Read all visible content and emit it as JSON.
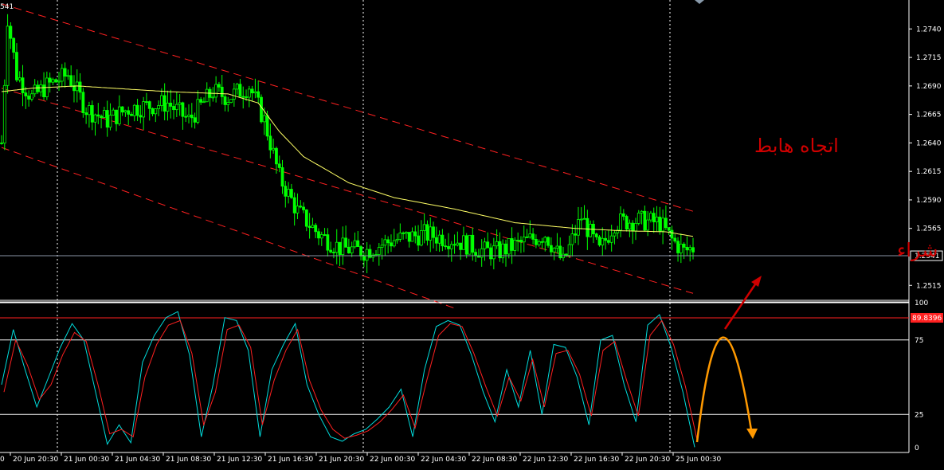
{
  "chart_data": [
    {
      "type": "candlestick",
      "title": "",
      "corner_label": "541",
      "ylim": [
        1.2504,
        1.2757
      ],
      "yticks": [
        "1.2740",
        "1.2715",
        "1.2690",
        "1.2665",
        "1.2640",
        "1.2615",
        "1.2590",
        "1.2565",
        "1.2515"
      ],
      "ytick_values": [
        1.274,
        1.2715,
        1.269,
        1.2665,
        1.264,
        1.2615,
        1.259,
        1.2565,
        1.2515
      ],
      "current_price": "1.2541",
      "current_price_value": 1.2541,
      "bull_color": "#00ff00",
      "bear_color": "#00ff00",
      "moving_average_color": "#ffff66",
      "channel_color": "#ff2020",
      "anchors": [
        [
          0,
          1.264
        ],
        [
          2,
          1.275
        ],
        [
          5,
          1.27
        ],
        [
          10,
          1.268
        ],
        [
          15,
          1.269
        ],
        [
          22,
          1.27
        ],
        [
          28,
          1.267
        ],
        [
          35,
          1.266
        ],
        [
          42,
          1.267
        ],
        [
          55,
          1.2675
        ],
        [
          62,
          1.266
        ],
        [
          70,
          1.2685
        ],
        [
          75,
          1.268
        ],
        [
          82,
          1.269
        ],
        [
          87,
          1.266
        ],
        [
          92,
          1.261
        ],
        [
          98,
          1.258
        ],
        [
          105,
          1.256
        ],
        [
          112,
          1.2548
        ],
        [
          120,
          1.2545
        ],
        [
          130,
          1.2555
        ],
        [
          140,
          1.256
        ],
        [
          150,
          1.2555
        ],
        [
          160,
          1.2545
        ],
        [
          165,
          1.2545
        ],
        [
          170,
          1.255
        ],
        [
          180,
          1.256
        ],
        [
          186,
          1.2535
        ],
        [
          192,
          1.2575
        ],
        [
          198,
          1.2545
        ],
        [
          203,
          1.257
        ],
        [
          210,
          1.2572
        ],
        [
          218,
          1.257
        ],
        [
          222,
          1.2555
        ],
        [
          226,
          1.2545
        ],
        [
          229,
          1.2548
        ]
      ],
      "ma_anchors": [
        [
          0,
          1.2685
        ],
        [
          10,
          1.2688
        ],
        [
          25,
          1.269
        ],
        [
          55,
          1.2685
        ],
        [
          75,
          1.2683
        ],
        [
          85,
          1.2675
        ],
        [
          92,
          1.265
        ],
        [
          100,
          1.2628
        ],
        [
          115,
          1.2605
        ],
        [
          130,
          1.2592
        ],
        [
          150,
          1.2582
        ],
        [
          170,
          1.257
        ],
        [
          190,
          1.2565
        ],
        [
          205,
          1.2563
        ],
        [
          220,
          1.2562
        ],
        [
          229,
          1.2558
        ]
      ],
      "channel_lines": [
        {
          "from": [
            0,
            1.2762
          ],
          "to": [
            229,
            1.258
          ]
        },
        {
          "from": [
            0,
            1.2688
          ],
          "to": [
            229,
            1.2508
          ]
        },
        {
          "from": [
            0,
            1.2636
          ],
          "to": [
            150,
            1.2495
          ]
        }
      ],
      "annotations": [
        "اتجاه هابط",
        "في انتظار اشاره شراء"
      ]
    },
    {
      "type": "line",
      "title": "",
      "ylim": [
        0,
        100
      ],
      "yticks": [
        "100",
        "75",
        "25",
        "0"
      ],
      "ytick_values": [
        100,
        75,
        25,
        0
      ],
      "level_label": "89.8396",
      "level_value": 89.8396,
      "level_color": "#ff2020",
      "hlines": [
        100,
        75,
        25
      ],
      "series": [
        {
          "color": "#00dddd",
          "values": [
            45,
            82,
            55,
            30,
            50,
            70,
            86,
            75,
            40,
            5,
            18,
            6,
            60,
            78,
            90,
            94,
            65,
            10,
            45,
            90,
            88,
            68,
            10,
            55,
            72,
            86,
            45,
            25,
            10,
            7,
            12,
            15,
            22,
            30,
            42,
            10,
            55,
            84,
            88,
            85,
            65,
            40,
            20,
            55,
            30,
            68,
            25,
            72,
            70,
            50,
            18,
            75,
            78,
            45,
            20,
            85,
            92,
            70,
            40,
            3
          ]
        },
        {
          "color": "#ff2020",
          "values": [
            40,
            75,
            58,
            35,
            45,
            65,
            80,
            74,
            45,
            12,
            15,
            10,
            50,
            72,
            85,
            88,
            66,
            18,
            40,
            82,
            85,
            70,
            18,
            48,
            68,
            82,
            48,
            28,
            15,
            9,
            11,
            14,
            20,
            28,
            38,
            16,
            48,
            78,
            86,
            84,
            66,
            44,
            24,
            50,
            34,
            62,
            30,
            66,
            68,
            52,
            24,
            68,
            74,
            48,
            24,
            78,
            88,
            72,
            44,
            8
          ]
        }
      ]
    }
  ],
  "x_labels": [
    "20 Jun 20:30",
    "21 Jun 00:30",
    "21 Jun 04:30",
    "21 Jun 08:30",
    "21 Jun 12:30",
    "21 Jun 16:30",
    "21 Jun 20:30",
    "22 Jun 00:30",
    "22 Jun 04:30",
    "22 Jun 08:30",
    "22 Jun 12:30",
    "22 Jun 16:30",
    "22 Jun 20:30",
    "25 Jun 00:30"
  ],
  "x_label_left_edge": "0"
}
